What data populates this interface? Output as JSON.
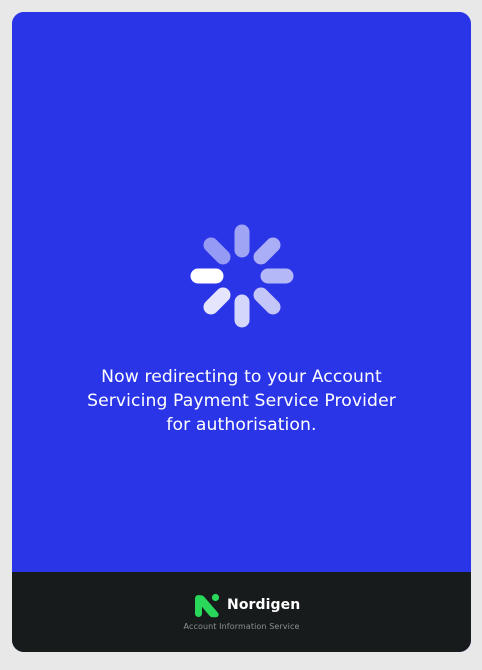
{
  "redirect": {
    "message_lines": [
      "Now redirecting to your Account",
      "Servicing Payment Service Provider",
      "for authorisation."
    ]
  },
  "footer": {
    "brand_name": "Nordigen",
    "tagline": "Account Information Service"
  },
  "colors": {
    "primary_blue": "#2b35e8",
    "footer_dark": "#181b1c",
    "brand_green": "#29d85a",
    "text_white": "#ffffff",
    "tagline_gray": "#8b9192"
  },
  "icons": {
    "spinner": "loading-spinner-icon",
    "logo": "nordigen-logo-icon"
  }
}
